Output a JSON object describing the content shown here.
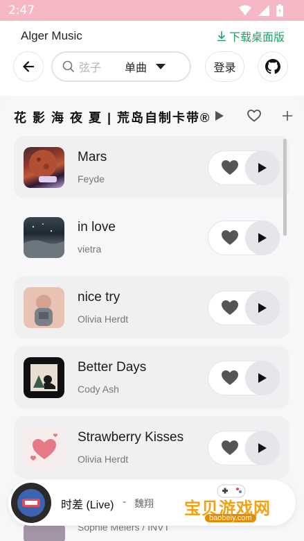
{
  "status_bar": {
    "time": "2:47"
  },
  "app": {
    "title": "Alger Music",
    "download_label": "下载桌面版"
  },
  "search": {
    "placeholder": "弦子",
    "type_label": "单曲"
  },
  "header": {
    "login_label": "登录"
  },
  "playlist": {
    "title": "花 影 海 夜 夏 | 荒岛自制卡带®",
    "songs": [
      {
        "name": "Mars",
        "artist": "Feyde"
      },
      {
        "name": "in love",
        "artist": "vietra"
      },
      {
        "name": "nice try",
        "artist": "Olivia Herdt"
      },
      {
        "name": "Better Days",
        "artist": "Cody Ash"
      },
      {
        "name": "Strawberry Kisses",
        "artist": "Olivia Herdt"
      },
      {
        "artist": "Sophie Meiers / INVT"
      }
    ]
  },
  "player": {
    "title": "时差 (Live)",
    "separator": "-",
    "artist": "魏翔"
  },
  "watermark": {
    "text": "宝贝游戏网",
    "url": "baobeiy.com"
  },
  "colors": {
    "status_bar": "#f6b8c5",
    "accent_green": "#22a06b",
    "watermark": "#f2a20e"
  }
}
